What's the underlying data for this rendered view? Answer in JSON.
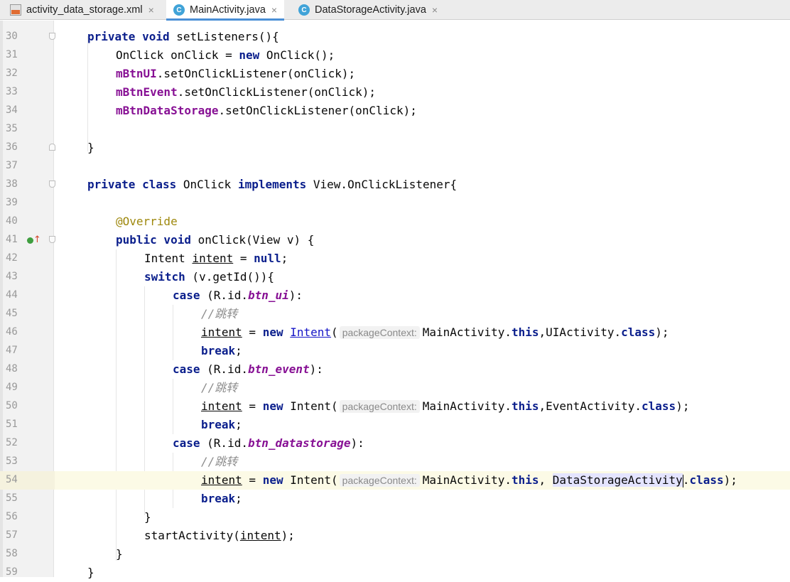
{
  "tabs": [
    {
      "label": "activity_data_storage.xml",
      "icon": "xml-file-icon",
      "active": false
    },
    {
      "label": "MainActivity.java",
      "icon": "java-class-icon",
      "active": true
    },
    {
      "label": "DataStorageActivity.java",
      "icon": "java-class-icon",
      "active": false
    }
  ],
  "close_glyph": "×",
  "java_icon_letter": "C",
  "line_numbers": [
    "30",
    "31",
    "32",
    "33",
    "34",
    "35",
    "36",
    "37",
    "38",
    "39",
    "40",
    "41",
    "42",
    "43",
    "44",
    "45",
    "46",
    "47",
    "48",
    "49",
    "50",
    "51",
    "52",
    "53",
    "54",
    "55",
    "56",
    "57",
    "58",
    "59"
  ],
  "code": {
    "l30": {
      "kw1": "private void",
      "rest": " setListeners(){"
    },
    "l31": {
      "a": "OnClick onClick = ",
      "kw": "new",
      "b": " OnClick();"
    },
    "l32": {
      "field": "mBtnUI",
      "rest": ".setOnClickListener(onClick);"
    },
    "l33": {
      "field": "mBtnEvent",
      "rest": ".setOnClickListener(onClick);"
    },
    "l34": {
      "field": "mBtnDataStorage",
      "rest": ".setOnClickListener(onClick);"
    },
    "l36": {
      "text": "}"
    },
    "l38": {
      "kw1": "private class",
      "mid": " OnClick ",
      "kw2": "implements",
      "rest": " View.OnClickListener{"
    },
    "l40": {
      "ann": "@Override"
    },
    "l41": {
      "kw": "public void",
      "rest": " onClick(View v) {"
    },
    "l42": {
      "a": "Intent ",
      "var": "intent",
      "b": " = ",
      "kw": "null",
      "c": ";"
    },
    "l43": {
      "kw": "switch",
      "rest": " (v.getId()){"
    },
    "l44": {
      "kw": "case",
      "a": " (R.id.",
      "id": "btn_ui",
      "b": "):"
    },
    "l45": {
      "comment": "//跳转"
    },
    "l46": {
      "var": "intent",
      "a": " = ",
      "kw": "new",
      "sp": " ",
      "cls": "Intent",
      "b": "(",
      "hint": "packageContext:",
      "c": "MainActivity.",
      "kw2": "this",
      "d": ",UIActivity.",
      "kw3": "class",
      "e": ");"
    },
    "l47": {
      "kw": "break",
      "rest": ";"
    },
    "l48": {
      "kw": "case",
      "a": " (R.id.",
      "id": "btn_event",
      "b": "):"
    },
    "l49": {
      "comment": "//跳转"
    },
    "l50": {
      "var": "intent",
      "a": " = ",
      "kw": "new",
      "b": " Intent(",
      "hint": "packageContext:",
      "c": "MainActivity.",
      "kw2": "this",
      "d": ",EventActivity.",
      "kw3": "class",
      "e": ");"
    },
    "l51": {
      "kw": "break",
      "rest": ";"
    },
    "l52": {
      "kw": "case",
      "a": " (R.id.",
      "id": "btn_datastorage",
      "b": "):"
    },
    "l53": {
      "comment": "//跳转"
    },
    "l54": {
      "var": "intent",
      "a": " = ",
      "kw": "new",
      "b": " Intent(",
      "hint": "packageContext:",
      "c": "MainActivity.",
      "kw2": "this",
      "d": ", ",
      "sel": "DataStorageActivity",
      "dot": ".",
      "kw3": "class",
      "e": ");"
    },
    "l55": {
      "kw": "break",
      "rest": ";"
    },
    "l56": {
      "text": "}"
    },
    "l57": {
      "a": "startActivity(",
      "var": "intent",
      "b": ");"
    },
    "l58": {
      "text": "}"
    },
    "l59": {
      "text": "}"
    }
  },
  "colors": {
    "keyword": "#0a1e8c",
    "field": "#871094",
    "annotation": "#9e880d",
    "comment": "#8c8c8c",
    "highlight_line": "#fcfae6",
    "tab_underline": "#4a8fd6"
  }
}
